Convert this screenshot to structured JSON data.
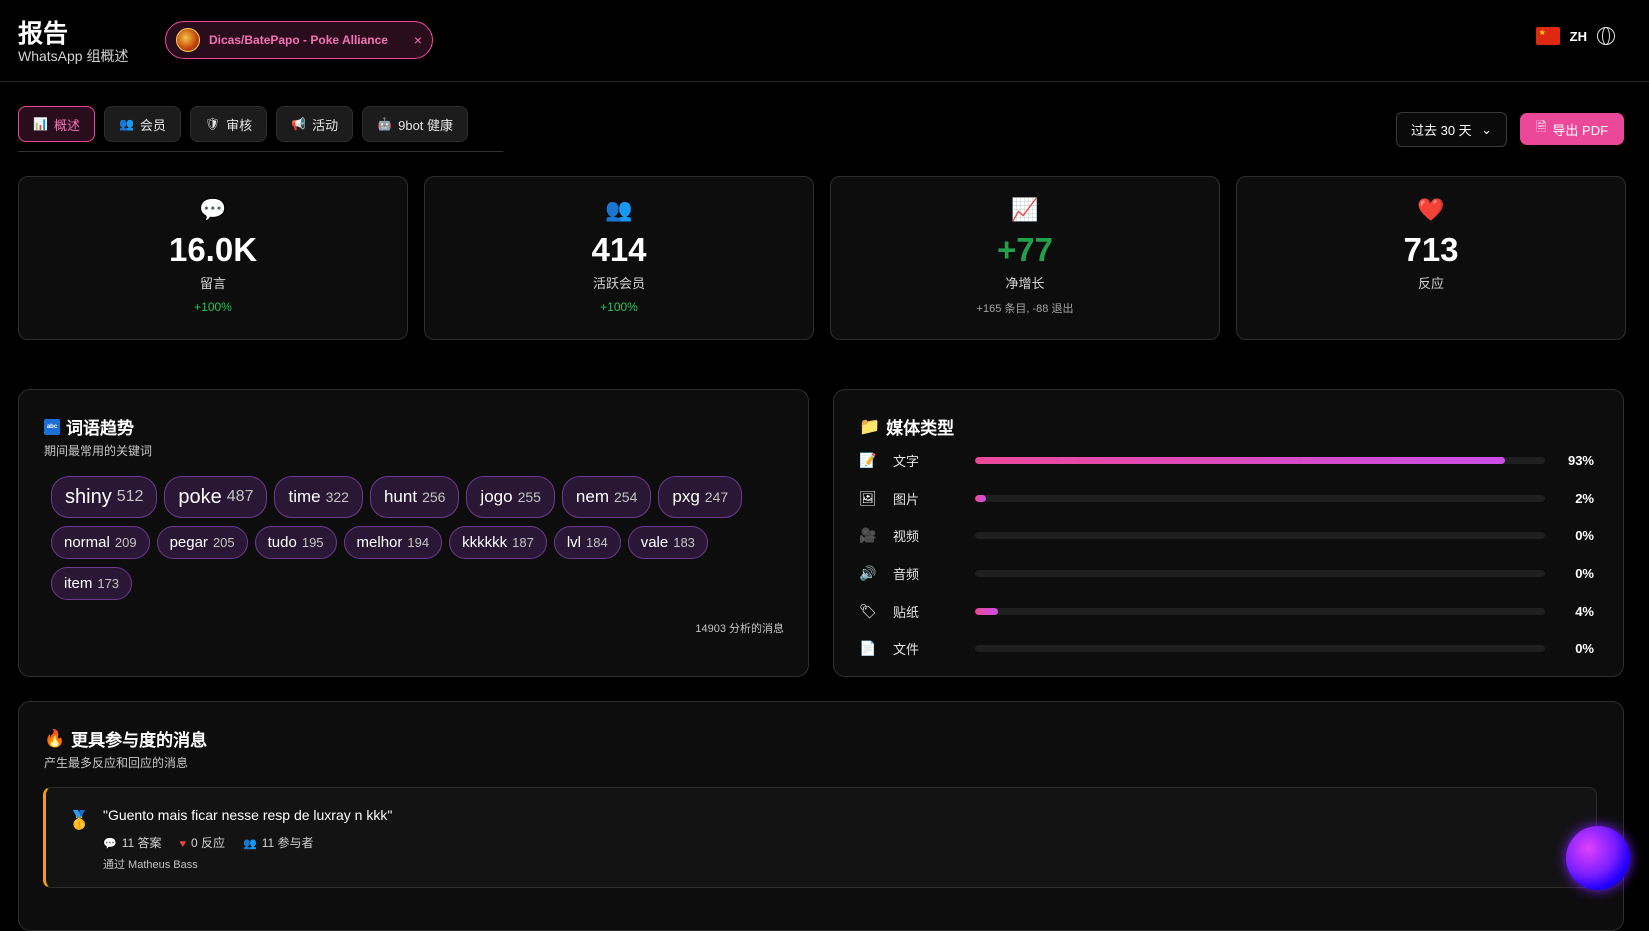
{
  "header": {
    "title": "报告",
    "subtitle": "WhatsApp 组概述",
    "group_name": "Dicas/BatePapo - Poke Alliance",
    "group_close": "×",
    "lang_code": "ZH"
  },
  "tabs": [
    {
      "label": "概述",
      "icon": "📊"
    },
    {
      "label": "会员",
      "icon": "👥"
    },
    {
      "label": "审核",
      "icon": "🛡"
    },
    {
      "label": "活动",
      "icon": "📢"
    },
    {
      "label": "9bot 健康",
      "icon": "🤖"
    }
  ],
  "controls": {
    "range": "过去 30 天",
    "range_caret": "⌄",
    "export": "导出 PDF"
  },
  "stats": [
    {
      "icon": "💬",
      "value": "16.0K",
      "label": "留言",
      "sub": "+100%"
    },
    {
      "icon": "👥",
      "value": "414",
      "label": "活跃会员",
      "sub": "+100%"
    },
    {
      "icon": "📈",
      "value": "+77",
      "label": "净增长",
      "sub": "+165 条目, -88 退出"
    },
    {
      "icon": "❤️",
      "value": "713",
      "label": "反应",
      "sub": ""
    }
  ],
  "words": {
    "title": "词语趋势",
    "subtitle": "期间最常用的关键词",
    "tags": [
      {
        "word": "shiny",
        "count": "512"
      },
      {
        "word": "poke",
        "count": "487"
      },
      {
        "word": "time",
        "count": "322"
      },
      {
        "word": "hunt",
        "count": "256"
      },
      {
        "word": "jogo",
        "count": "255"
      },
      {
        "word": "nem",
        "count": "254"
      },
      {
        "word": "pxg",
        "count": "247"
      },
      {
        "word": "normal",
        "count": "209"
      },
      {
        "word": "pegar",
        "count": "205"
      },
      {
        "word": "tudo",
        "count": "195"
      },
      {
        "word": "melhor",
        "count": "194"
      },
      {
        "word": "kkkkkk",
        "count": "187"
      },
      {
        "word": "lvl",
        "count": "184"
      },
      {
        "word": "vale",
        "count": "183"
      },
      {
        "word": "item",
        "count": "173"
      }
    ],
    "analyzed": "14903 分析的消息"
  },
  "media": {
    "title": "媒体类型",
    "rows": [
      {
        "icon": "📝",
        "label": "文字",
        "pct": "93%",
        "value": 93
      },
      {
        "icon": "🖼",
        "label": "图片",
        "pct": "2%",
        "value": 2
      },
      {
        "icon": "🎥",
        "label": "视频",
        "pct": "0%",
        "value": 0
      },
      {
        "icon": "🔊",
        "label": "音频",
        "pct": "0%",
        "value": 0
      },
      {
        "icon": "🏷",
        "label": "贴纸",
        "pct": "4%",
        "value": 4
      },
      {
        "icon": "📄",
        "label": "文件",
        "pct": "0%",
        "value": 0
      }
    ]
  },
  "engaged": {
    "title": "更具参与度的消息",
    "subtitle": "产生最多反应和回应的消息",
    "top": {
      "quote": "\"Guento mais ficar nesse resp de luxray n kkk\"",
      "replies": "11 答案",
      "reactions": "0 反应",
      "participants": "11 参与者",
      "by": "通过 Matheus Bass"
    }
  }
}
